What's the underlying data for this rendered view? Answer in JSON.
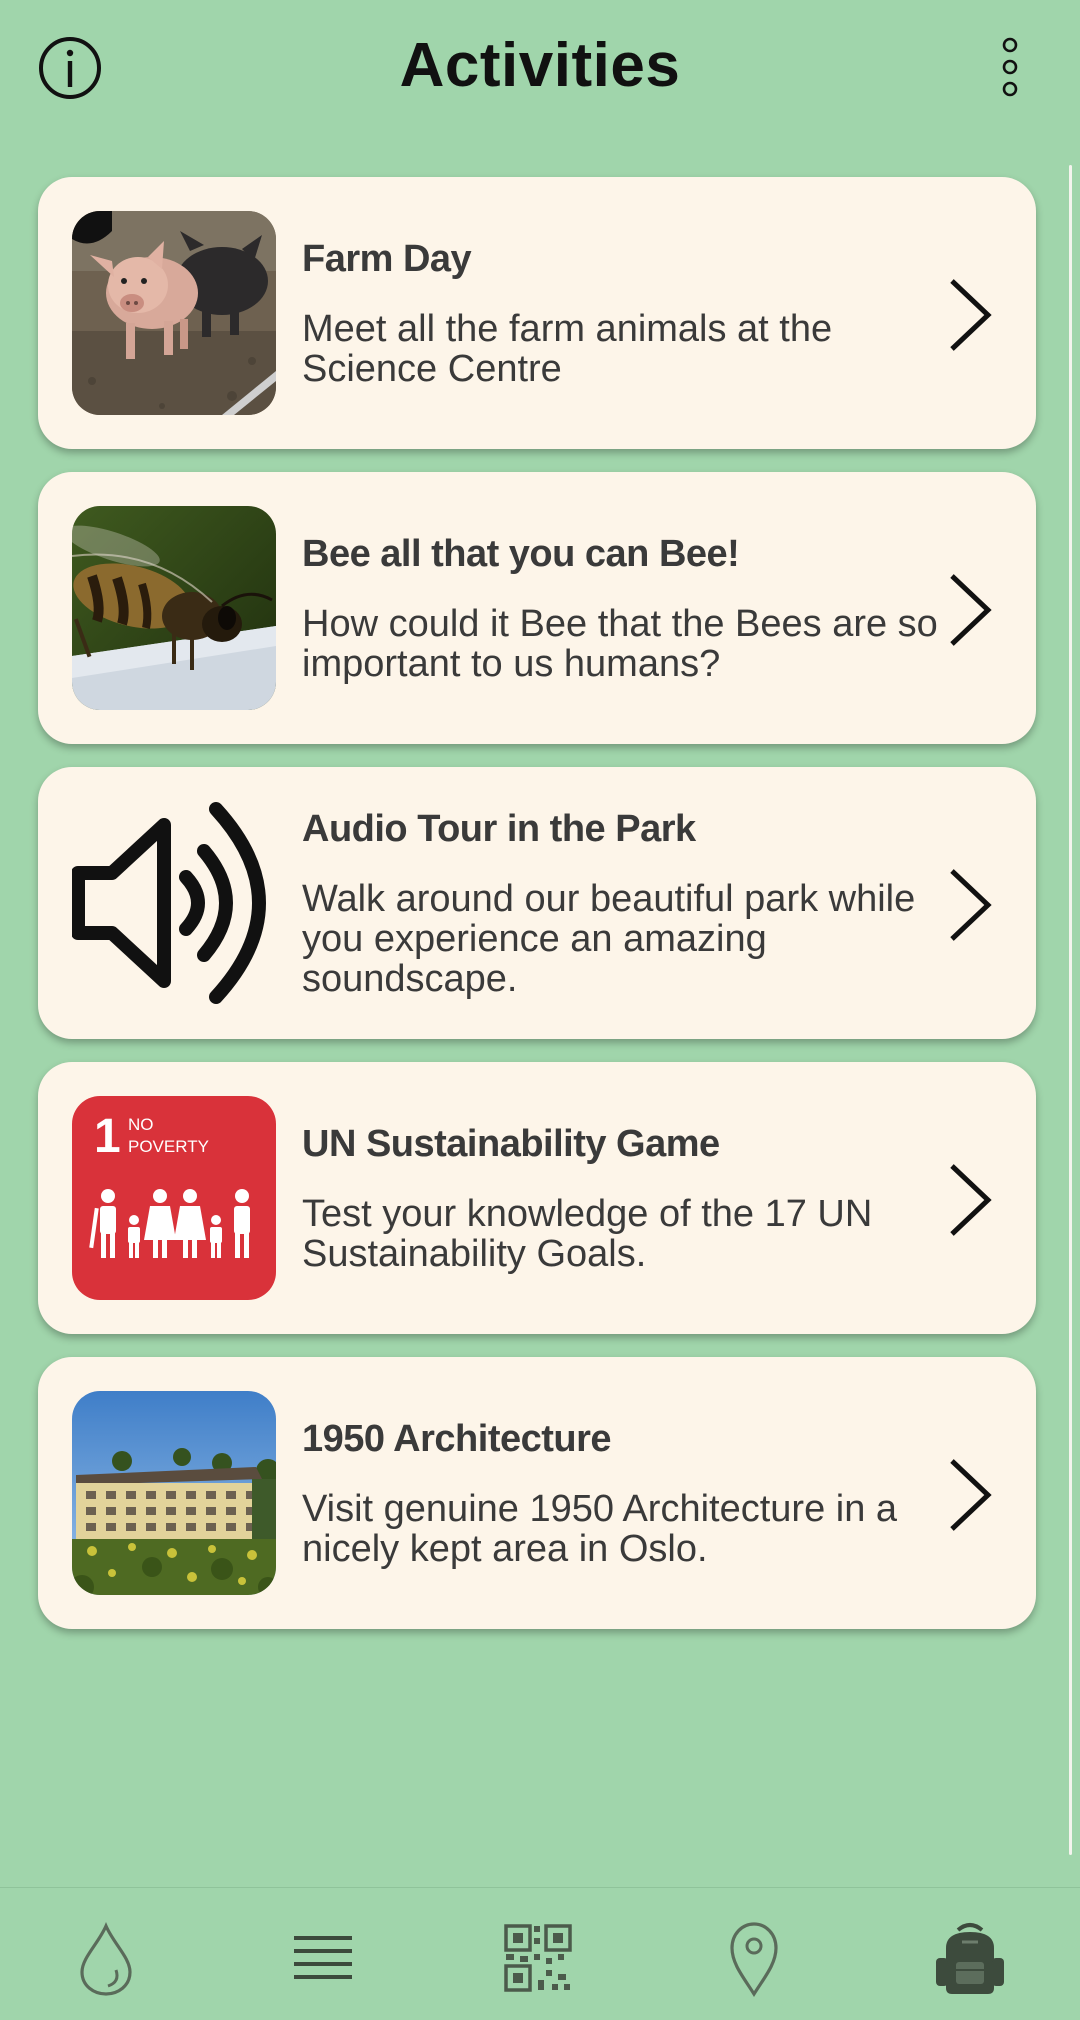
{
  "header": {
    "title": "Activities",
    "info_icon": "info-circle-icon",
    "menu_icon": "vertical-dots-icon"
  },
  "activities": [
    {
      "title": "Farm Day",
      "description": "Meet all the farm animals at the Science Centre",
      "image": "pigs-photo"
    },
    {
      "title": "Bee all that you can Bee!",
      "description": "How could it Bee that the Bees are so important to us humans?",
      "image": "bee-photo"
    },
    {
      "title": "Audio Tour in the Park",
      "description": "Walk around our beautiful park while you experience an amazing soundscape.",
      "image": "speaker-icon"
    },
    {
      "title": "UN Sustainability Game",
      "description": "Test your knowledge of the 17 UN Sustainability Goals.",
      "image": "sdg-no-poverty-tile",
      "image_text": {
        "number": "1",
        "line1": "NO",
        "line2": "POVERTY"
      }
    },
    {
      "title": "1950 Architecture",
      "description": "Visit genuine 1950 Architecture in a nicely kept area in Oslo.",
      "image": "apartment-building-photo"
    }
  ],
  "bottom_nav": [
    {
      "name": "droplet-icon"
    },
    {
      "name": "list-icon"
    },
    {
      "name": "qr-code-icon"
    },
    {
      "name": "map-pin-icon"
    },
    {
      "name": "backpack-icon"
    }
  ],
  "colors": {
    "background": "#a0d5ab",
    "card": "#fdf5e9",
    "text": "#3a3a3a",
    "sdg_red": "#d9323a"
  }
}
